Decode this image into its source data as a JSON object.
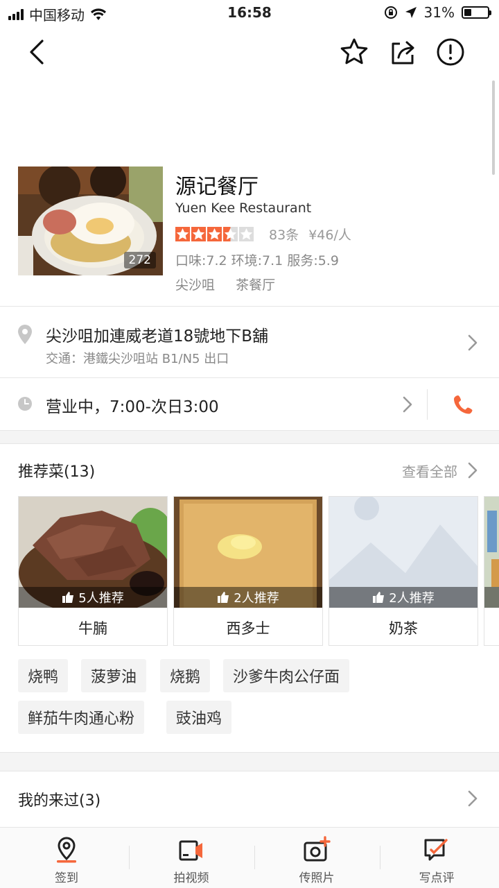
{
  "status_bar": {
    "carrier": "中国移动",
    "time": "16:58",
    "battery_percent": "31%",
    "battery_level": 0.31
  },
  "navbar": {
    "icons": [
      "back-icon",
      "star-icon",
      "share-icon",
      "report-icon"
    ]
  },
  "shop": {
    "name": "源记餐厅",
    "english_name": "Yuen Kee Restaurant",
    "photo_count": "272",
    "rating_stars": 3.5,
    "review_count": "83条",
    "avg_price": "¥46/人",
    "scores": "口味:7.2 环境:7.1 服务:5.9",
    "district": "尖沙咀",
    "category": "茶餐厅"
  },
  "address": {
    "main": "尖沙咀加連威老道18號地下B舖",
    "transit": "交通：港鐵尖沙咀站 B1/N5 出口"
  },
  "hours": {
    "text": "营业中，7:00-次日3:00"
  },
  "recommended": {
    "title": "推荐菜(13)",
    "view_all": "查看全部",
    "dishes": [
      {
        "name": "牛腩",
        "recommend": "5人推荐"
      },
      {
        "name": "西多士",
        "recommend": "2人推荐"
      },
      {
        "name": "奶茶",
        "recommend": "2人推荐"
      }
    ],
    "tags": [
      "烧鸭",
      "菠萝油",
      "烧鹅",
      "沙爹牛肉公仔面",
      "鲜茄牛肉通心粉",
      "豉油鸡"
    ]
  },
  "visited": {
    "label": "我的来过(3)"
  },
  "tabbar": {
    "tabs": [
      {
        "label": "签到"
      },
      {
        "label": "拍视频"
      },
      {
        "label": "传照片"
      },
      {
        "label": "写点评"
      }
    ]
  },
  "colors": {
    "accent": "#f5673b",
    "star_empty": "#dddddd",
    "separator": "#e6e6e6"
  }
}
